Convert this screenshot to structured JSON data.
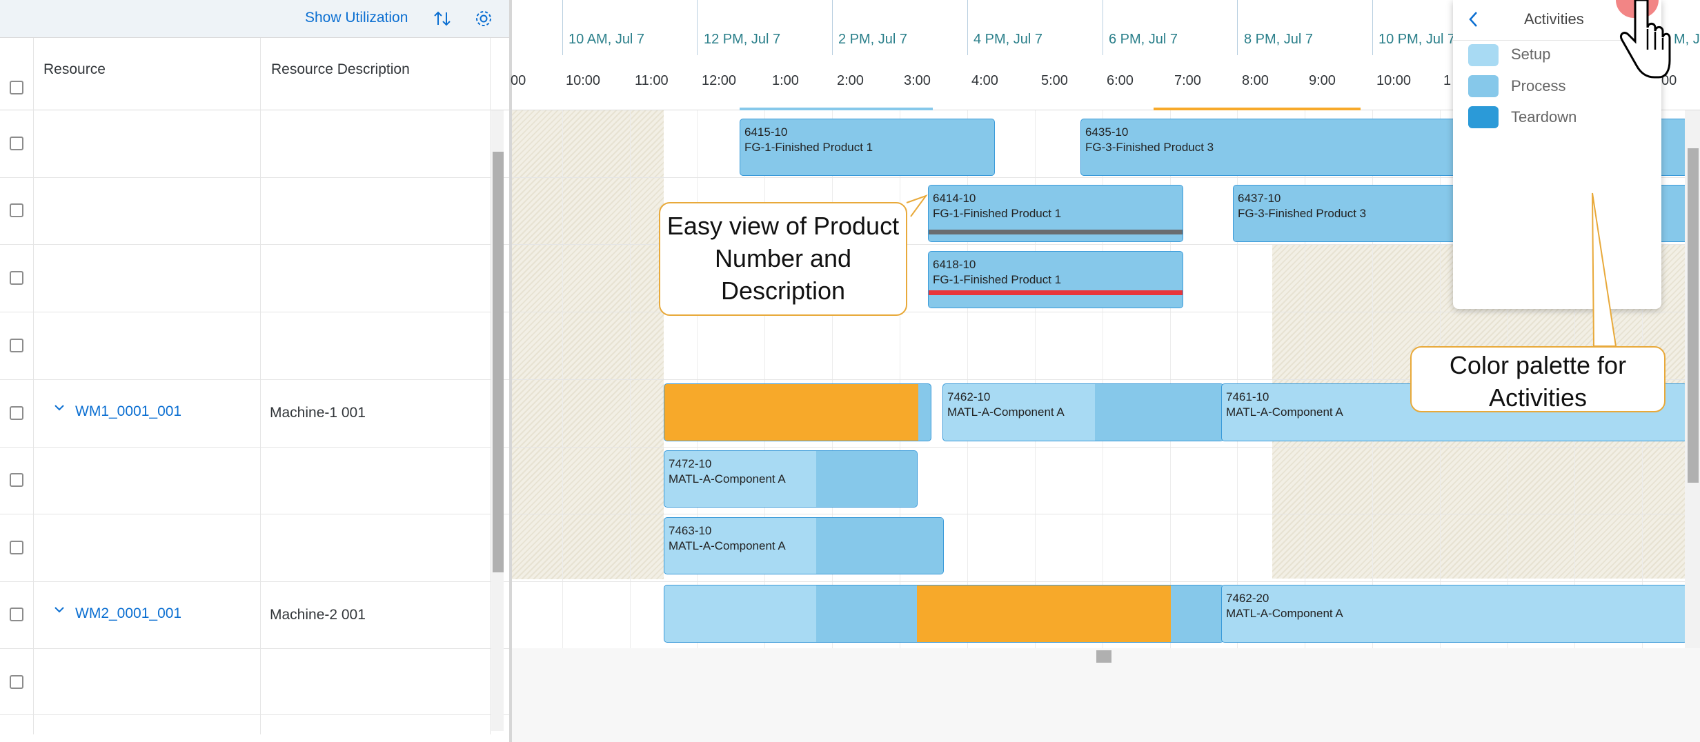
{
  "toolbar": {
    "show_utilization": "Show Utilization",
    "sort_icon": "sort-icon",
    "settings_icon": "settings-icon"
  },
  "table": {
    "columns": [
      "Resource",
      "Resource Description"
    ],
    "rows": [
      {
        "resource": "",
        "description": ""
      },
      {
        "resource": "",
        "description": ""
      },
      {
        "resource": "",
        "description": ""
      },
      {
        "resource": "",
        "description": ""
      },
      {
        "resource": "WM1_0001_001",
        "description": "Machine-1 001",
        "expandable": true
      },
      {
        "resource": "",
        "description": ""
      },
      {
        "resource": "",
        "description": ""
      },
      {
        "resource": "WM2_0001_001",
        "description": "Machine-2 001",
        "expandable": true
      },
      {
        "resource": "",
        "description": ""
      }
    ]
  },
  "timeline": {
    "top": [
      "10 AM, Jul 7",
      "12 PM, Jul 7",
      "2 PM, Jul 7",
      "4 PM, Jul 7",
      "6 PM, Jul 7",
      "8 PM, Jul 7",
      "10 PM, Jul 7",
      "M, J"
    ],
    "sub": [
      "00",
      "10:00",
      "11:00",
      "12:00",
      "1:00",
      "2:00",
      "3:00",
      "4:00",
      "5:00",
      "6:00",
      "7:00",
      "8:00",
      "9:00",
      "10:00",
      "1",
      "00"
    ]
  },
  "bars": {
    "b1": {
      "id": "6415-10",
      "desc": "FG-1-Finished Product 1"
    },
    "b2": {
      "id": "6435-10",
      "desc": "FG-3-Finished Product 3"
    },
    "b3": {
      "id": "6414-10",
      "desc": "FG-1-Finished Product 1"
    },
    "b4": {
      "id": "6437-10",
      "desc": "FG-3-Finished Product 3"
    },
    "b5": {
      "id": "6418-10",
      "desc": "FG-1-Finished Product 1"
    },
    "b6": {
      "id": "7462-10",
      "desc": "MATL-A-Component A"
    },
    "b7": {
      "id": "7461-10",
      "desc": "MATL-A-Component A"
    },
    "b8": {
      "id": "7472-10",
      "desc": "MATL-A-Component A"
    },
    "b9": {
      "id": "7463-10",
      "desc": "MATL-A-Component A"
    },
    "b10": {
      "id": "7462-20",
      "desc": "MATL-A-Component A"
    }
  },
  "callouts": {
    "product": "Easy view of Product Number and Description",
    "palette": "Color palette for Activities"
  },
  "palette": {
    "title": "Activities",
    "back_icon": "chevron-left-icon",
    "items": [
      {
        "label": "Setup",
        "color": "#a8daf3"
      },
      {
        "label": "Process",
        "color": "#86c8ea"
      },
      {
        "label": "Teardown",
        "color": "#2b9ad8"
      }
    ]
  },
  "colors": {
    "orange": "#f7a92a",
    "red_line": "#e8363b",
    "gray_line": "#6a6d70"
  }
}
